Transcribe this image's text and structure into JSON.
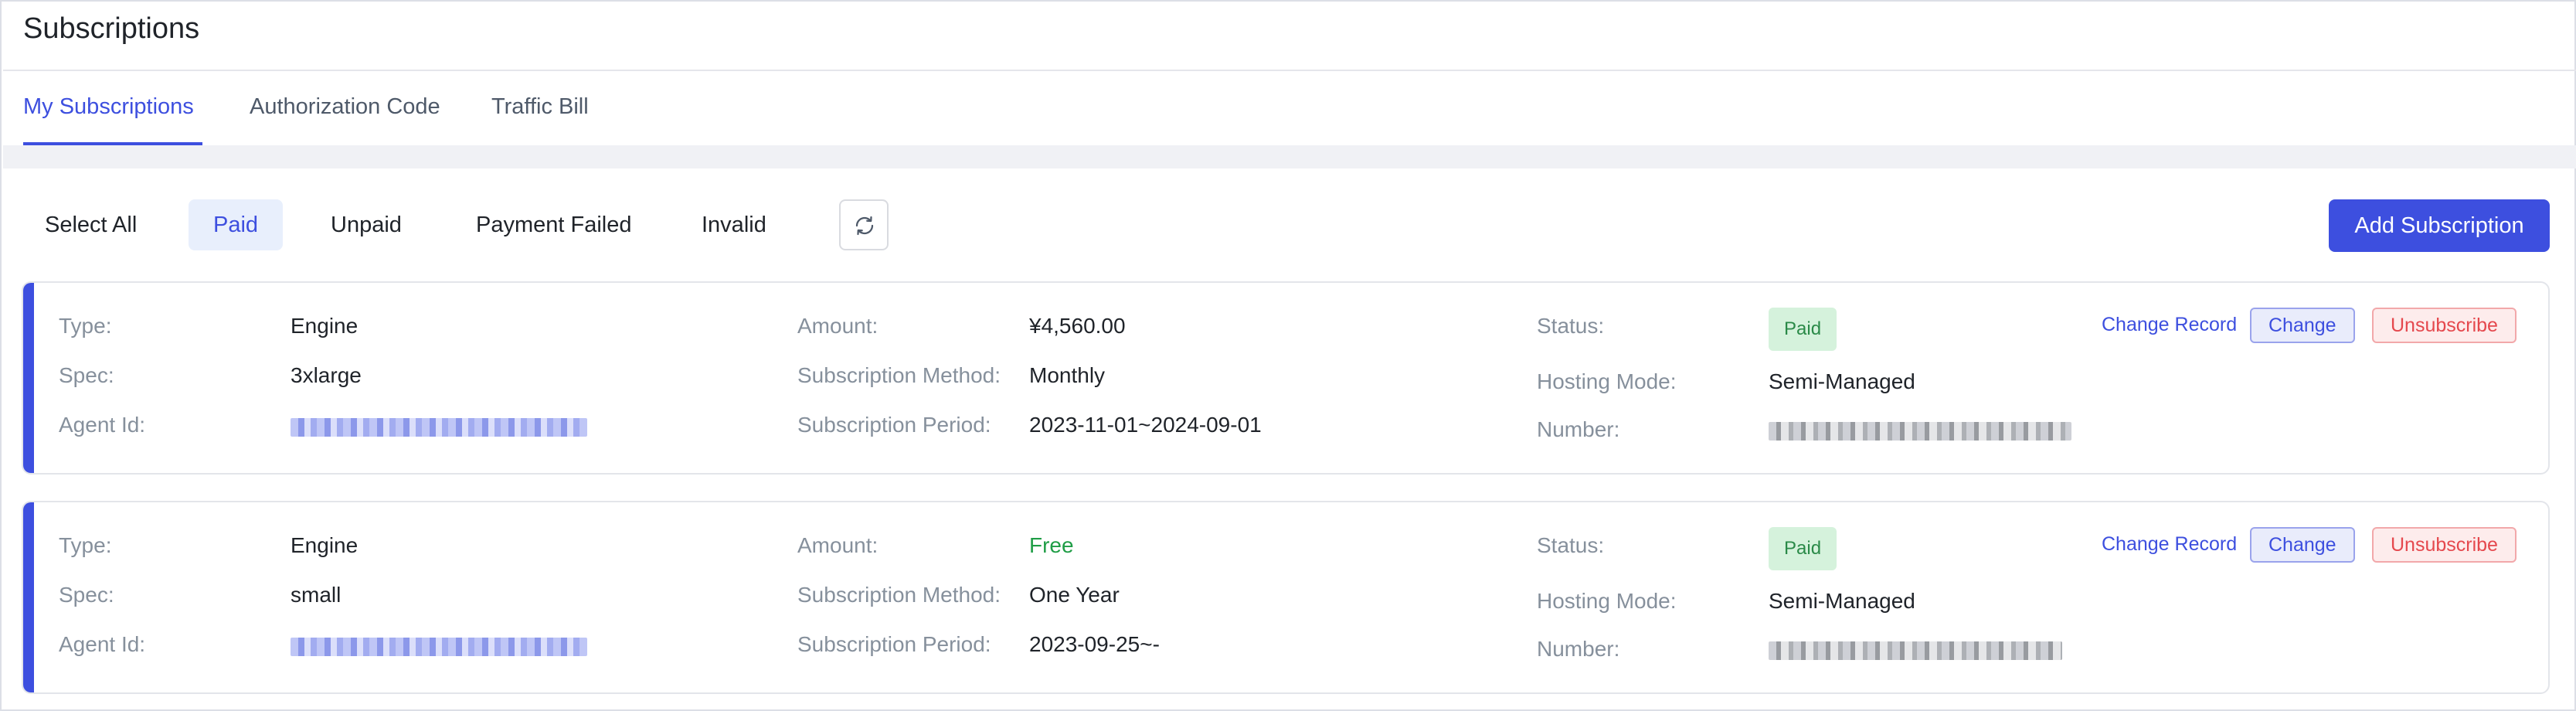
{
  "page": {
    "title": "Subscriptions"
  },
  "tabs": [
    {
      "label": "My Subscriptions",
      "active": true
    },
    {
      "label": "Authorization Code",
      "active": false
    },
    {
      "label": "Traffic Bill",
      "active": false
    }
  ],
  "filters": {
    "items": [
      {
        "label": "Select All",
        "active": false
      },
      {
        "label": "Paid",
        "active": true
      },
      {
        "label": "Unpaid",
        "active": false
      },
      {
        "label": "Payment Failed",
        "active": false
      },
      {
        "label": "Invalid",
        "active": false
      }
    ],
    "refresh_icon": "refresh-icon",
    "add_label": "Add Subscription"
  },
  "labels": {
    "type": "Type:",
    "spec": "Spec:",
    "agent_id": "Agent Id:",
    "amount": "Amount:",
    "method": "Subscription Method:",
    "period": "Subscription Period:",
    "status": "Status:",
    "hosting": "Hosting Mode:",
    "number": "Number:",
    "change_record": "Change Record",
    "change": "Change",
    "unsubscribe": "Unsubscribe"
  },
  "subscriptions": [
    {
      "type": "Engine",
      "spec": "3xlarge",
      "agent_id": "",
      "amount": "¥4,560.00",
      "method": "Monthly",
      "period": "2023-11-01~2024-09-01",
      "status": "Paid",
      "hosting": "Semi-Managed",
      "number": ""
    },
    {
      "type": "Engine",
      "spec": "small",
      "agent_id": "",
      "amount": "Free",
      "method": "One Year",
      "period": "2023-09-25~-",
      "status": "Paid",
      "hosting": "Semi-Managed",
      "number": ""
    }
  ],
  "colors": {
    "accent": "#3d4fdf",
    "paid_badge_bg": "#d5f2dc",
    "paid_badge_text": "#2a8a48",
    "free_text": "#1f9d46",
    "danger": "#e5484d"
  }
}
